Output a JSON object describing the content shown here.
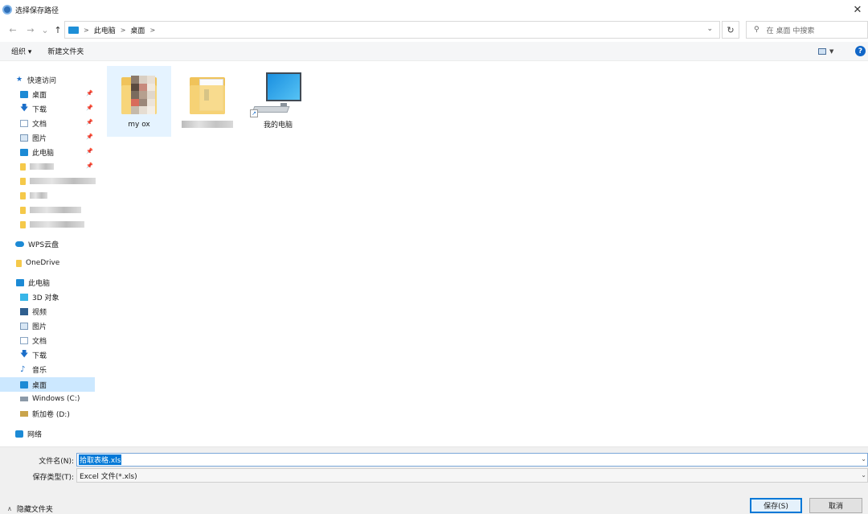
{
  "window": {
    "title": "选择保存路径",
    "close": "✕"
  },
  "nav": {
    "back": "←",
    "forward": "→",
    "recent": "⌄",
    "up": "↑",
    "refresh": "↻"
  },
  "address": {
    "crumbs": [
      "此电脑",
      "桌面"
    ],
    "separator": ">"
  },
  "search": {
    "placeholder": "在 桌面 中搜索"
  },
  "toolbar": {
    "organize": "组织 ▾",
    "new_folder": "新建文件夹",
    "help": "?"
  },
  "sidebar": {
    "quick_access": "快速访问",
    "quick_items": [
      {
        "label": "桌面",
        "icon": "desktop-icon",
        "pinned": true
      },
      {
        "label": "下载",
        "icon": "download-icon",
        "pinned": true
      },
      {
        "label": "文档",
        "icon": "document-icon",
        "pinned": true
      },
      {
        "label": "图片",
        "icon": "pictures-icon",
        "pinned": true
      },
      {
        "label": "此电脑",
        "icon": "computer-icon",
        "pinned": true
      },
      {
        "label": "",
        "icon": "folder-icon",
        "pinned": true
      }
    ],
    "wps_cloud": "WPS云盘",
    "onedrive": "OneDrive",
    "this_pc": "此电脑",
    "pc_items": [
      {
        "label": "3D 对象",
        "icon": "3d-objects-icon"
      },
      {
        "label": "视频",
        "icon": "video-icon"
      },
      {
        "label": "图片",
        "icon": "pictures-icon"
      },
      {
        "label": "文档",
        "icon": "document-icon"
      },
      {
        "label": "下载",
        "icon": "download-icon"
      },
      {
        "label": "音乐",
        "icon": "music-icon"
      },
      {
        "label": "桌面",
        "icon": "desktop-icon",
        "selected": true
      },
      {
        "label": "Windows (C:)",
        "icon": "drive-icon"
      },
      {
        "label": "新加卷 (D:)",
        "icon": "drive-icon"
      }
    ],
    "network": "网络"
  },
  "files": [
    {
      "label": "my    ox",
      "type": "folder",
      "selected": true
    },
    {
      "label": "",
      "type": "folder"
    },
    {
      "label": "我的电脑",
      "type": "shortcut"
    }
  ],
  "form": {
    "filename_label": "文件名(N):",
    "filename_value": "拾取表格.xls",
    "filetype_label": "保存类型(T):",
    "filetype_value": "Excel 文件(*.xls)",
    "hide_folders": "隐藏文件夹",
    "save": "保存(S)",
    "cancel": "取消"
  },
  "colors": {
    "accent": "#0078d7",
    "selection": "#cce8ff",
    "folder": "#f7d57a"
  }
}
